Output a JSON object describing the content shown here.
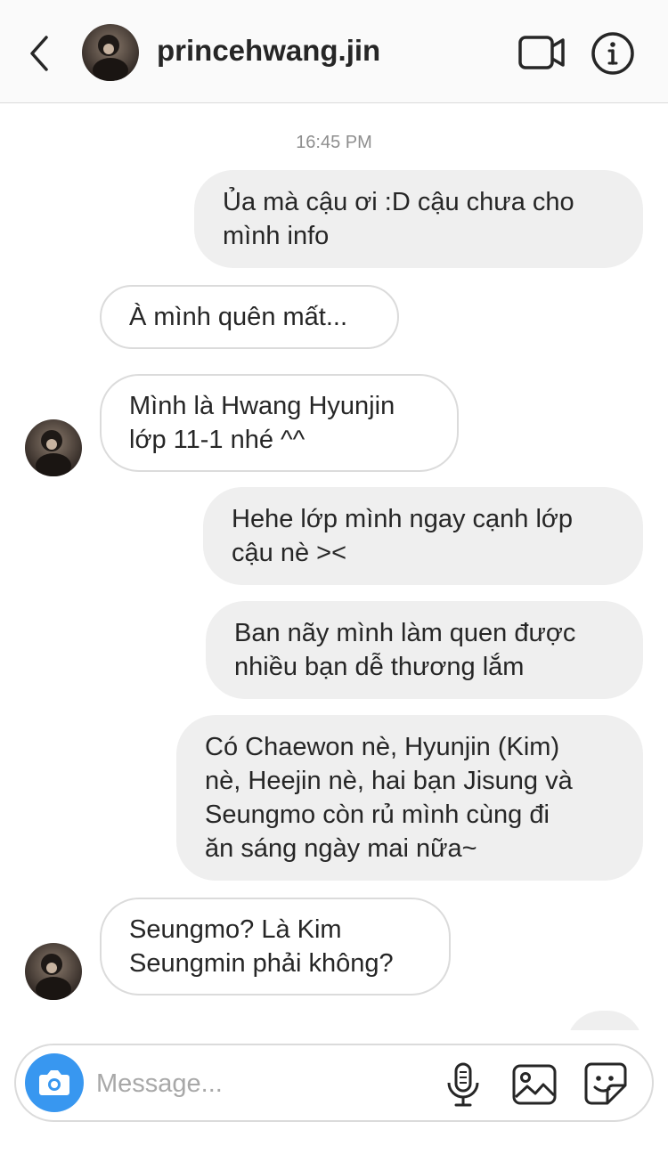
{
  "header": {
    "username": "princehwang.jin",
    "icons": {
      "back": "chevron-left-icon",
      "video": "video-camera-icon",
      "info": "info-icon"
    }
  },
  "thread": {
    "timestamp": "16:45 PM",
    "messages": [
      {
        "sender": "me",
        "lines": [
          "Ủa mà cậu ơi :D cậu chưa cho",
          "mình info"
        ]
      },
      {
        "sender": "them",
        "lines": [
          "À mình quên mất..."
        ]
      },
      {
        "sender": "them",
        "lines": [
          "Mình là Hwang Hyunjin",
          "lớp 11-1 nhé ^^"
        ]
      },
      {
        "sender": "me",
        "lines": [
          "Hehe lớp mình ngay cạnh lớp",
          "cậu nè ><"
        ]
      },
      {
        "sender": "me",
        "lines": [
          "Ban nãy mình làm quen được",
          "nhiều bạn dễ thương lắm"
        ]
      },
      {
        "sender": "me",
        "lines": [
          "Có Chaewon nè, Hyunjin (Kim)",
          "nè, Heejin nè, hai bạn Jisung và",
          "Seungmo còn rủ mình cùng đi",
          "ăn sáng ngày mai nữa~"
        ]
      },
      {
        "sender": "them",
        "lines": [
          "Seungmo? Là Kim",
          "Seungmin phải không?"
        ]
      }
    ]
  },
  "composer": {
    "placeholder": "Message...",
    "icons": {
      "camera": "camera-icon",
      "mic": "microphone-icon",
      "gallery": "image-icon",
      "sticker": "sticker-icon"
    }
  },
  "colors": {
    "accent": "#3897f0",
    "sent_bubble": "#efefef",
    "border": "#dbdbdb",
    "muted_text": "#8e8e8e"
  }
}
